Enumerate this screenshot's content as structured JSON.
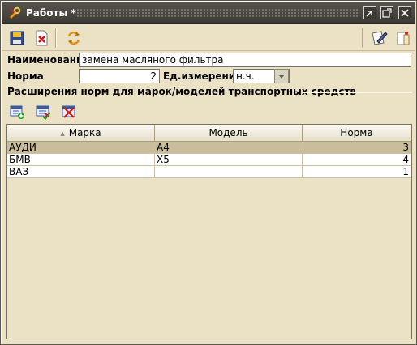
{
  "window": {
    "title": "Работы *"
  },
  "toolbar": {
    "left_icons": [
      "save-icon",
      "close-red-icon",
      "refresh-icon"
    ],
    "right_icons": [
      "edit-note-icon",
      "info-icon"
    ]
  },
  "form": {
    "name_label": "Наименование",
    "name_value": "замена масляного фильтра",
    "norm_label": "Норма",
    "norm_value": "2",
    "unit_label": "Ед.измерения",
    "unit_value": "н.ч."
  },
  "section": {
    "title": "Расширения норм для марок/моделей транспортных средств",
    "icons": [
      "add-record-icon",
      "edit-record-icon",
      "delete-record-icon"
    ]
  },
  "table": {
    "columns": [
      "Марка",
      "Модель",
      "Норма"
    ],
    "sorted_column": "Марка",
    "rows": [
      {
        "brand": "АУДИ",
        "model": "A4",
        "norm": "3",
        "selected": true
      },
      {
        "brand": "БМВ",
        "model": "X5",
        "norm": "4",
        "selected": false
      },
      {
        "brand": "ВАЗ",
        "model": "",
        "norm": "1",
        "selected": false
      }
    ]
  },
  "colors": {
    "background": "#ebe1c4",
    "titlebar": "#3d3a35",
    "selected_row": "#c9bd9b"
  }
}
